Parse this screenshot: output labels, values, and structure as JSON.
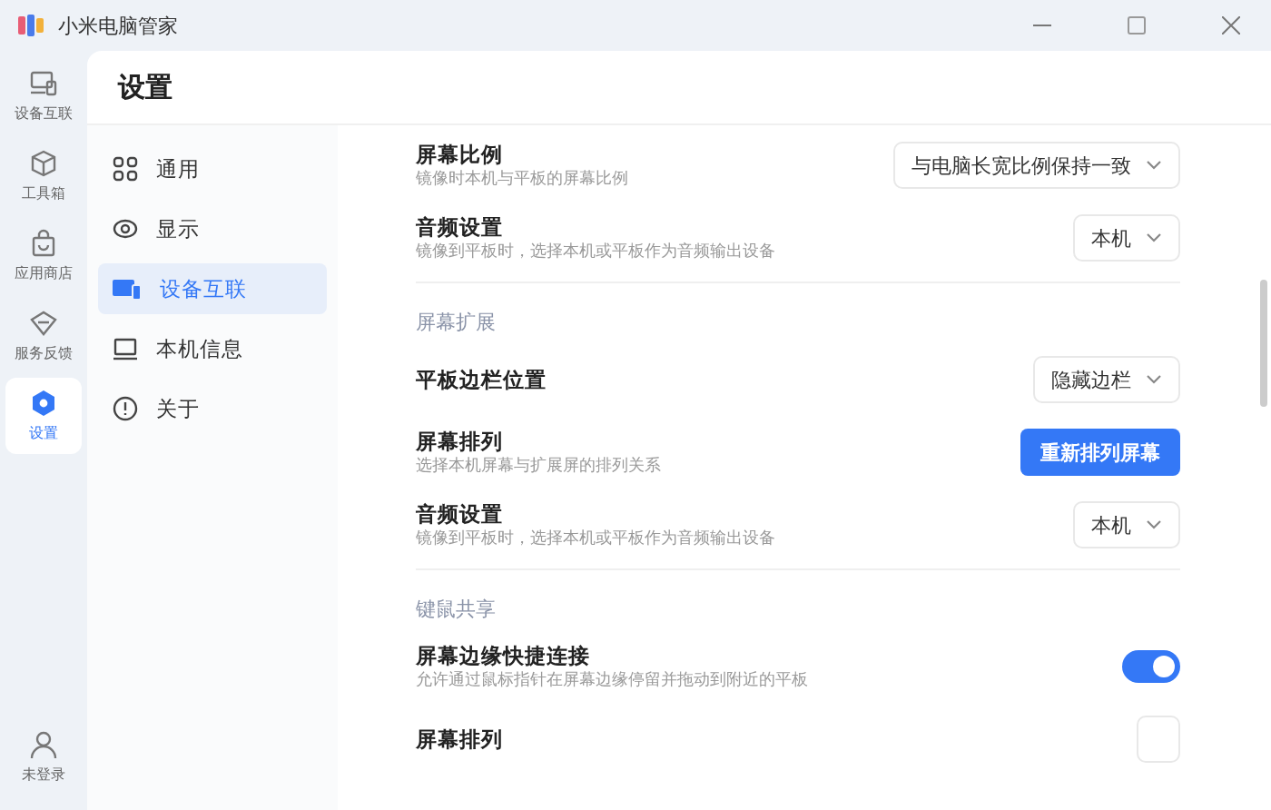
{
  "window": {
    "title": "小米电脑管家"
  },
  "rail": {
    "items": [
      {
        "label": "设备互联",
        "selected": false
      },
      {
        "label": "工具箱",
        "selected": false
      },
      {
        "label": "应用商店",
        "selected": false
      },
      {
        "label": "服务反馈",
        "selected": false
      },
      {
        "label": "设置",
        "selected": true
      }
    ],
    "user": {
      "label": "未登录"
    }
  },
  "page_title": "设置",
  "nav": {
    "items": [
      {
        "label": "通用",
        "selected": false
      },
      {
        "label": "显示",
        "selected": false
      },
      {
        "label": "设备互联",
        "selected": true
      },
      {
        "label": "本机信息",
        "selected": false
      },
      {
        "label": "关于",
        "selected": false
      }
    ]
  },
  "sections": [
    {
      "rows": [
        {
          "kind": "dropdown",
          "title": "屏幕比例",
          "description": "镜像时本机与平板的屏幕比例",
          "value": "与电脑长宽比例保持一致"
        },
        {
          "kind": "dropdown",
          "title": "音频设置",
          "description": "镜像到平板时，选择本机或平板作为音频输出设备",
          "value": "本机"
        }
      ]
    },
    {
      "heading": "屏幕扩展",
      "rows": [
        {
          "kind": "dropdown",
          "title": "平板边栏位置",
          "value": "隐藏边栏"
        },
        {
          "kind": "button",
          "title": "屏幕排列",
          "description": "选择本机屏幕与扩展屏的排列关系",
          "label": "重新排列屏幕"
        },
        {
          "kind": "dropdown",
          "title": "音频设置",
          "description": "镜像到平板时，选择本机或平板作为音频输出设备",
          "value": "本机"
        }
      ]
    },
    {
      "heading": "键鼠共享",
      "rows": [
        {
          "kind": "toggle",
          "title": "屏幕边缘快捷连接",
          "description": "允许通过鼠标指针在屏幕边缘停留并拖动到附近的平板",
          "on": true
        },
        {
          "kind": "dropdown",
          "title": "屏幕排列"
        }
      ]
    }
  ]
}
